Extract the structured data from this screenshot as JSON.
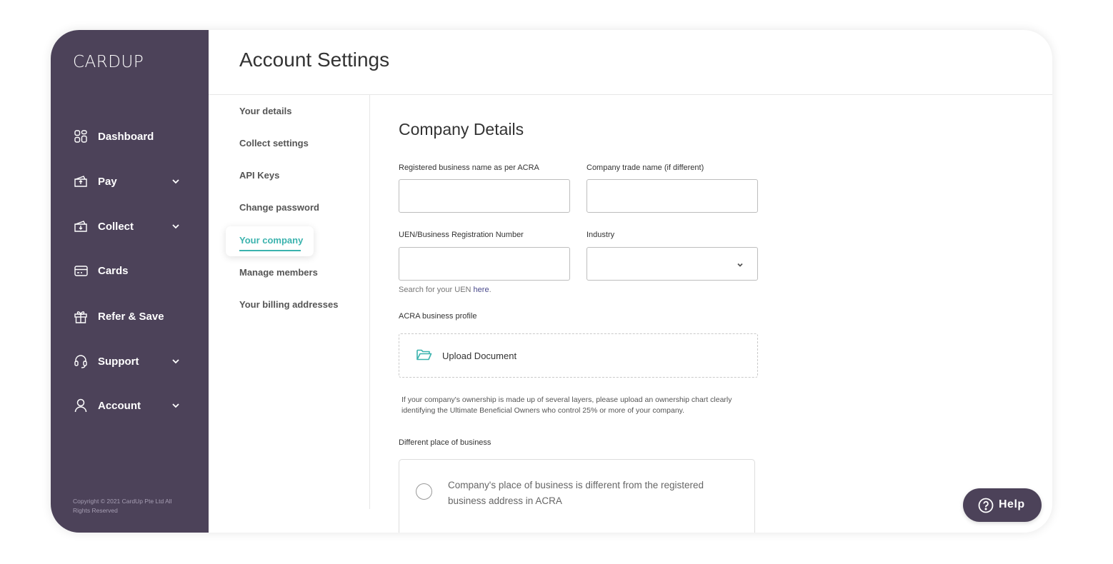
{
  "brand": {
    "logo_text": "CARDUP"
  },
  "sidebar": {
    "items": [
      {
        "label": "Dashboard",
        "icon": "dashboard-grid-icon"
      },
      {
        "label": "Pay",
        "icon": "pay-icon",
        "has_chevron": true
      },
      {
        "label": "Collect",
        "icon": "collect-icon",
        "has_chevron": true
      },
      {
        "label": "Cards",
        "icon": "card-icon"
      },
      {
        "label": "Refer & Save",
        "icon": "gift-icon"
      },
      {
        "label": "Support",
        "icon": "headset-icon",
        "has_chevron": true
      },
      {
        "label": "Account",
        "icon": "user-icon",
        "has_chevron": true
      }
    ],
    "copyright": "Copyright © 2021 CardUp Pte Ltd All Rights Reserved"
  },
  "header": {
    "title": "Account Settings"
  },
  "subnav": {
    "items": [
      {
        "label": "Your details"
      },
      {
        "label": "Collect settings"
      },
      {
        "label": "API Keys"
      },
      {
        "label": "Change password"
      },
      {
        "label": "Your company",
        "active": true
      },
      {
        "label": "Manage members"
      },
      {
        "label": "Your billing addresses"
      }
    ]
  },
  "form": {
    "section_title": "Company Details",
    "registered_name_label": "Registered business name as per ACRA",
    "registered_name_value": "",
    "trade_name_label": "Company trade name (if different)",
    "trade_name_value": "",
    "uen_label": "UEN/Business Registration Number",
    "uen_value": "",
    "industry_label": "Industry",
    "industry_value": "",
    "uen_hint_prefix": "Search for your UEN ",
    "uen_hint_link": "here",
    "uen_hint_suffix": ".",
    "acra_profile_label": "ACRA business profile",
    "upload_label": "Upload Document",
    "ownership_note": "If your company's ownership is made up of several layers, please upload an ownership chart clearly identifying the Ultimate Beneficial Owners who control 25% or more of your company.",
    "different_place_label": "Different place of business",
    "different_place_option": "Company's place of business is different from the registered business address in ACRA"
  },
  "help": {
    "label": "Help"
  },
  "colors": {
    "sidebar": "#4c4259",
    "accent": "#3bb3ae",
    "link": "#4a4a8c"
  }
}
